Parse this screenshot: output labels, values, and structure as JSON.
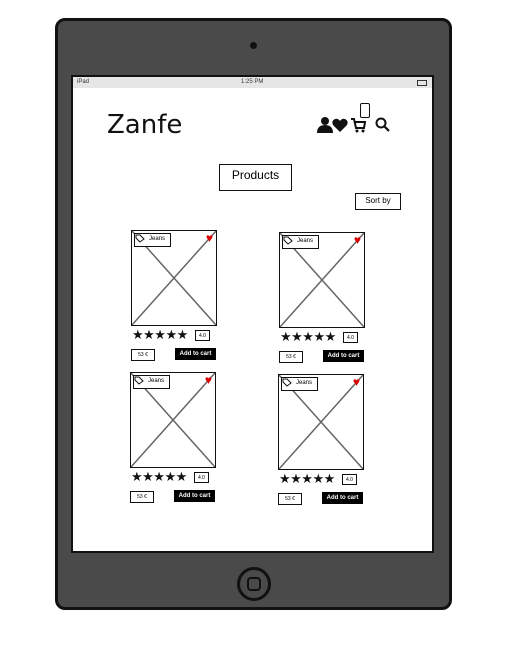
{
  "status_bar": {
    "device": "iPad",
    "time": "1:25 PM"
  },
  "header": {
    "brand": "Zanfe",
    "icons": [
      "user-icon",
      "heart-icon",
      "cart-icon",
      "search-icon",
      "phone-icon"
    ]
  },
  "main": {
    "products_button": "Products",
    "sort_button": "Sort by"
  },
  "products": [
    {
      "tag": "Jeans",
      "stars": "★★★★★",
      "rating": "4.0",
      "price": "53 €",
      "cart_label": "Add to cart"
    },
    {
      "tag": "Jeans",
      "stars": "★★★★★",
      "rating": "4.0",
      "price": "53 €",
      "cart_label": "Add to cart"
    },
    {
      "tag": "Jeans",
      "stars": "★★★★★",
      "rating": "4.0",
      "price": "53 €",
      "cart_label": "Add to cart"
    },
    {
      "tag": "Jeans",
      "stars": "★★★★★",
      "rating": "4.0",
      "price": "53 €",
      "cart_label": "Add to cart"
    }
  ],
  "colors": {
    "heart": "#d60000",
    "device_frame": "#4a4a4a",
    "button_dark": "#000000"
  }
}
